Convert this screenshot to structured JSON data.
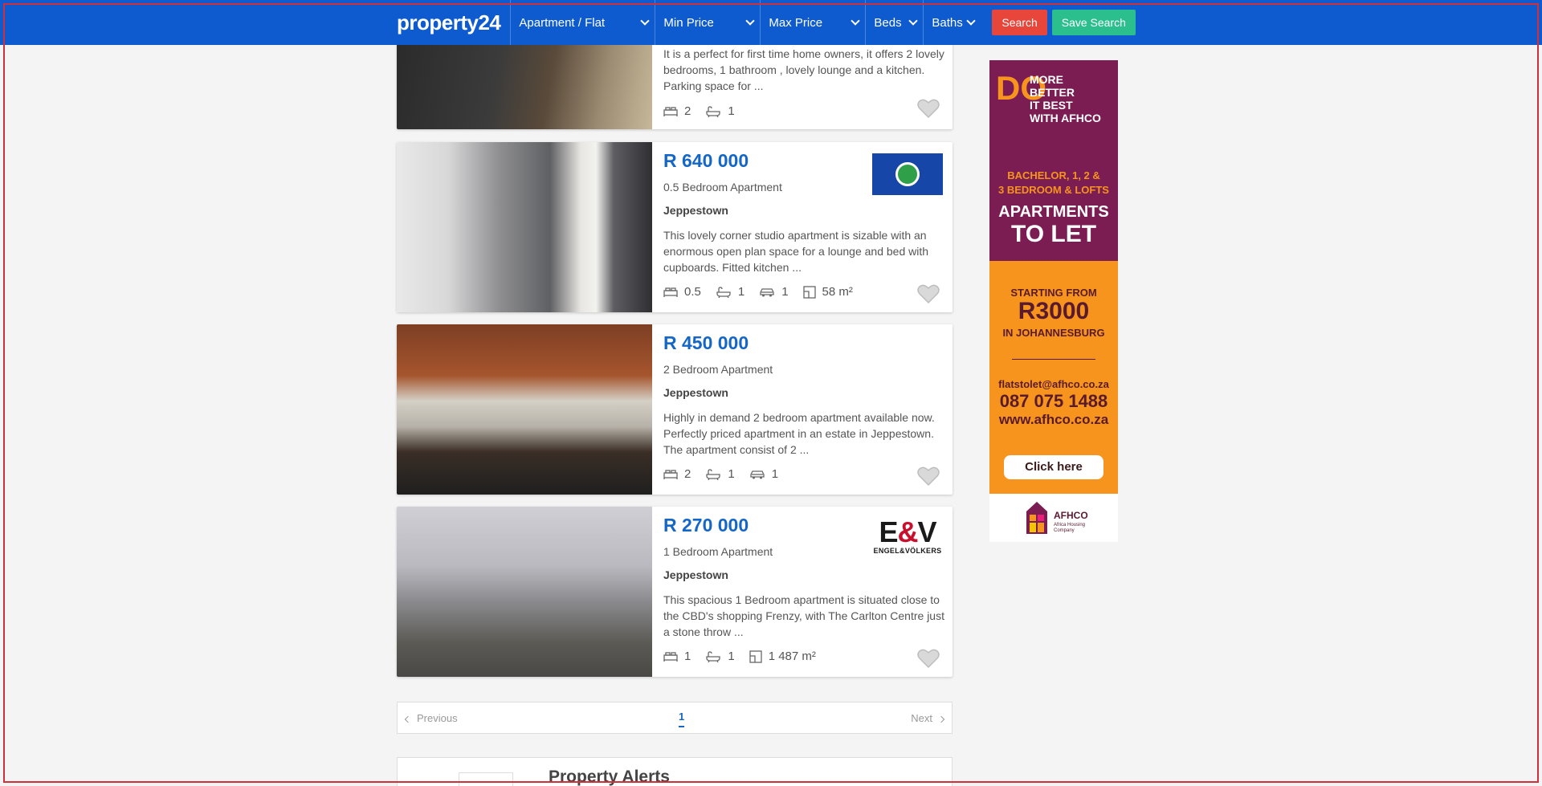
{
  "header": {
    "logo": "property24",
    "filters": [
      {
        "label": "Apartment / Flat"
      },
      {
        "label": "Min Price"
      },
      {
        "label": "Max Price"
      },
      {
        "label": "Beds"
      },
      {
        "label": "Baths"
      }
    ],
    "search_label": "Search",
    "save_search_label": "Save Search",
    "colors": {
      "bar": "#0e5bd0",
      "search": "#e8463b",
      "save": "#2bbf8e"
    }
  },
  "listings": [
    {
      "price": "",
      "type": "",
      "suburb": "",
      "description": "It is a perfect for first time home owners, it offers 2 lovely bedrooms, 1 bathroom , lovely lounge and a kitchen. Parking space for ...",
      "beds": "2",
      "baths": "1"
    },
    {
      "price": "R 640 000",
      "type": "0.5 Bedroom Apartment",
      "suburb": "Jeppestown",
      "description": "This lovely corner studio apartment is sizable with an enormous open plan space for a lounge and bed with cupboards. Fitted kitchen ...",
      "beds": "0.5",
      "baths": "1",
      "parking": "1",
      "size": "58 m²",
      "agency": "flag-seal-logo"
    },
    {
      "price": "R 450 000",
      "type": "2 Bedroom Apartment",
      "suburb": "Jeppestown",
      "description": "Highly in demand 2 bedroom apartment available now. Perfectly priced apartment in an estate in Jeppestown. The apartment consist of 2 ...",
      "beds": "2",
      "baths": "1",
      "parking": "1"
    },
    {
      "price": "R 270 000",
      "type": "1 Bedroom Apartment",
      "suburb": "Jeppestown",
      "description": "This spacious 1 Bedroom apartment is situated close to the CBD's shopping Frenzy, with The Carlton Centre just a stone throw ...",
      "beds": "1",
      "baths": "1",
      "size": "1 487 m²",
      "agency_logo": {
        "big_left": "E",
        "amp": "&",
        "big_right": "V",
        "small": "ENGEL&VÖLKERS"
      }
    }
  ],
  "pagination": {
    "previous": "Previous",
    "page": "1",
    "next": "Next"
  },
  "alerts": {
    "title": "Property Alerts"
  },
  "ad": {
    "do": "DO",
    "slogan_1": "MORE",
    "slogan_2": "BETTER",
    "slogan_3": "IT BEST",
    "slogan_4": "WITH AFHCO",
    "units_1": "BACHELOR, 1, 2 &",
    "units_2": "3 BEDROOM & LOFTS",
    "let_1": "APARTMENTS",
    "let_2": "TO LET",
    "from": "STARTING FROM",
    "price": "R3000",
    "city": "IN JOHANNESBURG",
    "email": "flatstolet@afhco.co.za",
    "phone": "087 075 1488",
    "web": "www.afhco.co.za",
    "cta": "Click here",
    "brand": "AFHCO",
    "brand_sub": "Africa Housing Company"
  }
}
